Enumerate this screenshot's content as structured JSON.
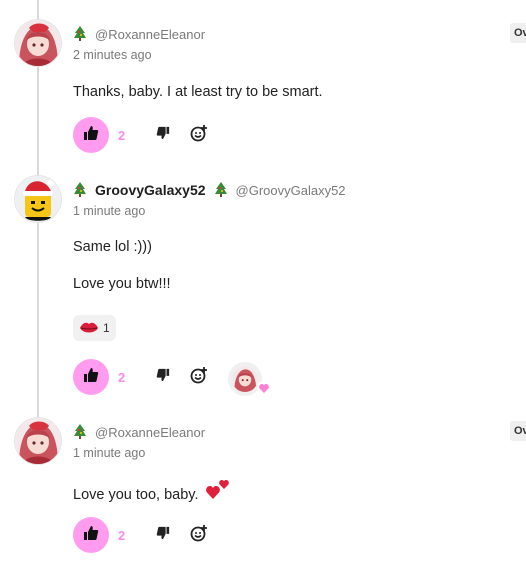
{
  "comments": [
    {
      "display_name": "",
      "handle": "@RoxanneEleanor",
      "timestamp": "2 minutes ago",
      "body": [
        "Thanks, baby. I at least try to be smart."
      ],
      "like_count": "2",
      "overflow_label": "Ov"
    },
    {
      "display_name": "GroovyGalaxy52",
      "handle": "@GroovyGalaxy52",
      "timestamp": "1 minute ago",
      "body": [
        "Same lol :)))",
        "Love you btw!!!"
      ],
      "reaction_count": "1",
      "like_count": "2"
    },
    {
      "display_name": "",
      "handle": "@RoxanneEleanor",
      "timestamp": "1 minute ago",
      "body": [
        "Love you too, baby."
      ],
      "like_count": "2",
      "overflow_label": "Ov"
    }
  ],
  "colors": {
    "like_accent": "#ff9cf0",
    "like_count": "#ff8ae8",
    "thread_line": "#d9d9d9"
  },
  "icons": [
    "tree-icon",
    "thumbs-up-icon",
    "thumbs-down-icon",
    "add-reaction-icon",
    "lips-icon",
    "heart-icon"
  ]
}
